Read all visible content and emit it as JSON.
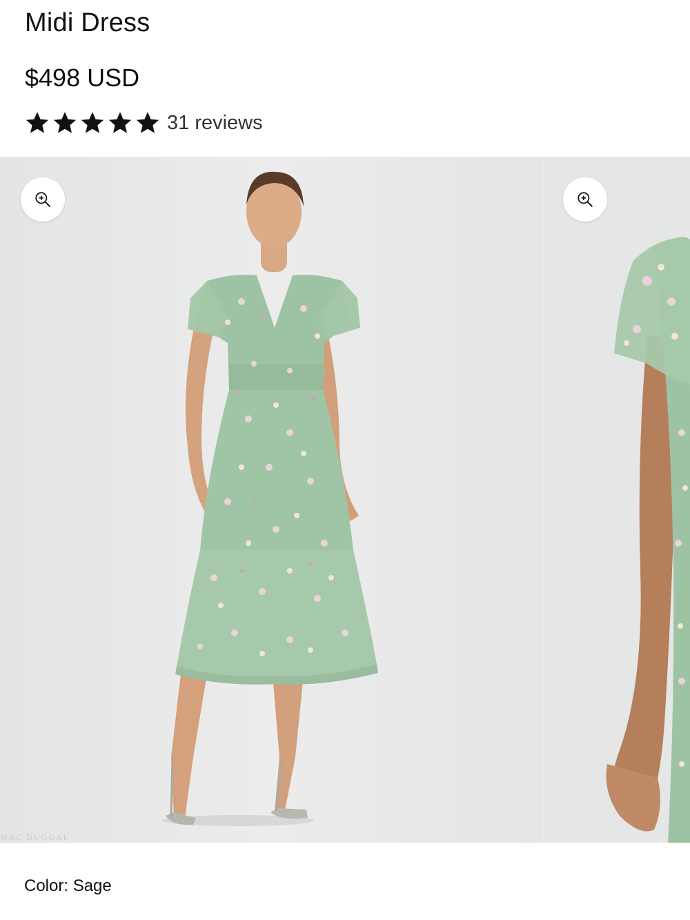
{
  "product": {
    "title": "Midi Dress",
    "price": "$498 USD",
    "rating": {
      "stars": 5,
      "max": 5,
      "reviews_label": "31 reviews"
    }
  },
  "gallery": {
    "zoom_icon": "zoom-in-icon",
    "watermark": "MAC DUGGAL",
    "dress_color": "#9ec3a4"
  },
  "options": {
    "color_label": "Color: Sage"
  }
}
